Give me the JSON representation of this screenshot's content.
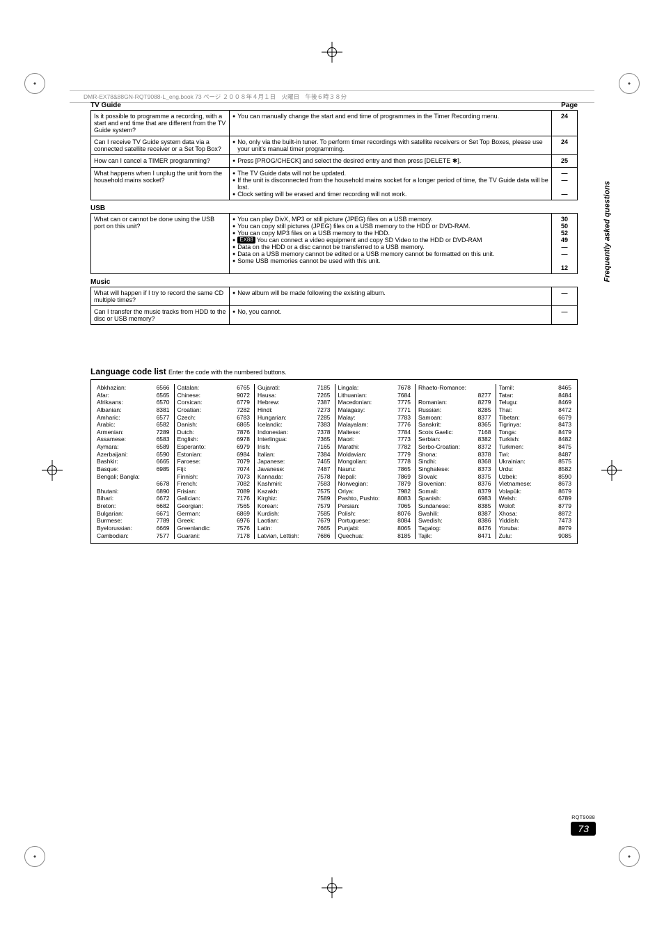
{
  "header_strip": "DMR-EX78&88GN-RQT9088-L_eng.book  73 ページ  ２００８年４月１日　火曜日　午後６時３８分",
  "side_label": "Frequently asked questions",
  "page_label": "Page",
  "sections": {
    "tvguide": {
      "title": "TV Guide",
      "rows": [
        {
          "q": "Is it possible to programme a recording, with a start and end time that are different from the TV Guide system?",
          "a": [
            "You can manually change the start and end time of programmes in the Timer Recording menu."
          ],
          "p": [
            "24"
          ]
        },
        {
          "q": "Can I receive TV Guide system data via a connected satellite receiver or a Set Top Box?",
          "a": [
            "No, only via the built-in tuner. To perform timer recordings with satellite receivers or Set Top Boxes, please use your unit's manual timer programming."
          ],
          "p": [
            "24"
          ]
        },
        {
          "q": "How can I cancel a TIMER programming?",
          "a": [
            "Press [PROG/CHECK] and select the desired entry and then press [DELETE ✱]."
          ],
          "p": [
            "25"
          ]
        },
        {
          "q": "What happens when I unplug the unit from the household mains socket?",
          "a": [
            "The TV Guide data will not be updated.",
            "If the unit is disconnected from the household mains socket for a longer period of time, the TV Guide data will be lost.",
            "Clock setting will be erased and timer recording will not work."
          ],
          "p": [
            "—",
            "—",
            "",
            "—"
          ]
        }
      ]
    },
    "usb": {
      "title": "USB",
      "rows": [
        {
          "q": "What can or cannot be done using the USB port on this unit?",
          "a": [
            "You can play DivX, MP3 or still picture (JPEG) files on a USB memory.",
            "You can copy still pictures (JPEG) files on a USB memory to the HDD or DVD-RAM.",
            "You can copy MP3 files on a USB memory to the HDD.",
            {
              "badge": "EX88",
              "text": "You can connect a video equipment and copy SD Video to the HDD or DVD-RAM"
            },
            "Data on the HDD or a disc cannot be transferred to a USB memory.",
            "Data on a USB memory cannot be edited or a USB memory cannot be formatted on this unit.",
            "Some USB memories cannot be used with this unit."
          ],
          "p": [
            "30",
            "50",
            "52",
            "49",
            "—",
            "—",
            "",
            "12"
          ]
        }
      ]
    },
    "music": {
      "title": "Music",
      "rows": [
        {
          "q": "What will happen if I try to record the same CD multiple times?",
          "a": [
            "New album will be made following the existing album."
          ],
          "p": [
            "—"
          ]
        },
        {
          "q": "Can I transfer the music tracks from HDD to the disc or USB memory?",
          "a": [
            "No, you cannot."
          ],
          "p": [
            "—"
          ]
        }
      ]
    }
  },
  "lang_title": "Language code list",
  "lang_sub": "Enter the code with the numbered buttons.",
  "lang_cols": [
    [
      [
        "Abkhazian:",
        "6566"
      ],
      [
        "Afar:",
        "6565"
      ],
      [
        "Afrikaans:",
        "6570"
      ],
      [
        "Albanian:",
        "8381"
      ],
      [
        "Amharic:",
        "6577"
      ],
      [
        "Arabic:",
        "6582"
      ],
      [
        "Armenian:",
        "7289"
      ],
      [
        "Assamese:",
        "6583"
      ],
      [
        "Aymara:",
        "6589"
      ],
      [
        "Azerbaijani:",
        "6590"
      ],
      [
        "Bashkir:",
        "6665"
      ],
      [
        "Basque:",
        "6985"
      ],
      [
        "Bengali; Bangla:",
        ""
      ],
      [
        "",
        "6678"
      ],
      [
        "Bhutani:",
        "6890"
      ],
      [
        "Bihari:",
        "6672"
      ],
      [
        "Breton:",
        "6682"
      ],
      [
        "Bulgarian:",
        "6671"
      ],
      [
        "Burmese:",
        "7789"
      ],
      [
        "Byelorussian:",
        "6669"
      ],
      [
        "Cambodian:",
        "7577"
      ]
    ],
    [
      [
        "Catalan:",
        "6765"
      ],
      [
        "Chinese:",
        "9072"
      ],
      [
        "Corsican:",
        "6779"
      ],
      [
        "Croatian:",
        "7282"
      ],
      [
        "Czech:",
        "6783"
      ],
      [
        "Danish:",
        "6865"
      ],
      [
        "Dutch:",
        "7876"
      ],
      [
        "English:",
        "6978"
      ],
      [
        "Esperanto:",
        "6979"
      ],
      [
        "Estonian:",
        "6984"
      ],
      [
        "Faroese:",
        "7079"
      ],
      [
        "Fiji:",
        "7074"
      ],
      [
        "Finnish:",
        "7073"
      ],
      [
        "French:",
        "7082"
      ],
      [
        "Frisian:",
        "7089"
      ],
      [
        "Galician:",
        "7176"
      ],
      [
        "Georgian:",
        "7565"
      ],
      [
        "German:",
        "6869"
      ],
      [
        "Greek:",
        "6976"
      ],
      [
        "Greenlandic:",
        "7576"
      ],
      [
        "Guarani:",
        "7178"
      ]
    ],
    [
      [
        "Gujarati:",
        "7185"
      ],
      [
        "Hausa:",
        "7265"
      ],
      [
        "Hebrew:",
        "7387"
      ],
      [
        "Hindi:",
        "7273"
      ],
      [
        "Hungarian:",
        "7285"
      ],
      [
        "Icelandic:",
        "7383"
      ],
      [
        "Indonesian:",
        "7378"
      ],
      [
        "Interlingua:",
        "7365"
      ],
      [
        "Irish:",
        "7165"
      ],
      [
        "Italian:",
        "7384"
      ],
      [
        "Japanese:",
        "7465"
      ],
      [
        "Javanese:",
        "7487"
      ],
      [
        "Kannada:",
        "7578"
      ],
      [
        "Kashmiri:",
        "7583"
      ],
      [
        "Kazakh:",
        "7575"
      ],
      [
        "Kirghiz:",
        "7589"
      ],
      [
        "Korean:",
        "7579"
      ],
      [
        "Kurdish:",
        "7585"
      ],
      [
        "Laotian:",
        "7679"
      ],
      [
        "Latin:",
        "7665"
      ],
      [
        "Latvian, Lettish:",
        "7686"
      ]
    ],
    [
      [
        "Lingala:",
        "7678"
      ],
      [
        "Lithuanian:",
        "7684"
      ],
      [
        "Macedonian:",
        "7775"
      ],
      [
        "Malagasy:",
        "7771"
      ],
      [
        "Malay:",
        "7783"
      ],
      [
        "Malayalam:",
        "7776"
      ],
      [
        "Maltese:",
        "7784"
      ],
      [
        "Maori:",
        "7773"
      ],
      [
        "Marathi:",
        "7782"
      ],
      [
        "Moldavian:",
        "7779"
      ],
      [
        "Mongolian:",
        "7778"
      ],
      [
        "Nauru:",
        "7865"
      ],
      [
        "Nepali:",
        "7869"
      ],
      [
        "Norwegian:",
        "7879"
      ],
      [
        "Oriya:",
        "7982"
      ],
      [
        "Pashto, Pushto:",
        "8083"
      ],
      [
        "Persian:",
        "7065"
      ],
      [
        "Polish:",
        "8076"
      ],
      [
        "Portuguese:",
        "8084"
      ],
      [
        "Punjabi:",
        "8065"
      ],
      [
        "Quechua:",
        "8185"
      ]
    ],
    [
      [
        "Rhaeto-Romance:",
        ""
      ],
      [
        "",
        "8277"
      ],
      [
        "Romanian:",
        "8279"
      ],
      [
        "Russian:",
        "8285"
      ],
      [
        "Samoan:",
        "8377"
      ],
      [
        "Sanskrit:",
        "8365"
      ],
      [
        "Scots Gaelic:",
        "7168"
      ],
      [
        "Serbian:",
        "8382"
      ],
      [
        "Serbo-Croatian:",
        "8372"
      ],
      [
        "Shona:",
        "8378"
      ],
      [
        "Sindhi:",
        "8368"
      ],
      [
        "Singhalese:",
        "8373"
      ],
      [
        "Slovak:",
        "8375"
      ],
      [
        "Slovenian:",
        "8376"
      ],
      [
        "Somali:",
        "8379"
      ],
      [
        "Spanish:",
        "6983"
      ],
      [
        "Sundanese:",
        "8385"
      ],
      [
        "Swahili:",
        "8387"
      ],
      [
        "Swedish:",
        "8386"
      ],
      [
        "Tagalog:",
        "8476"
      ],
      [
        "Tajik:",
        "8471"
      ]
    ],
    [
      [
        "Tamil:",
        "8465"
      ],
      [
        "Tatar:",
        "8484"
      ],
      [
        "Telugu:",
        "8469"
      ],
      [
        "Thai:",
        "8472"
      ],
      [
        "Tibetan:",
        "6679"
      ],
      [
        "Tigrinya:",
        "8473"
      ],
      [
        "Tonga:",
        "8479"
      ],
      [
        "Turkish:",
        "8482"
      ],
      [
        "Turkmen:",
        "8475"
      ],
      [
        "Twi:",
        "8487"
      ],
      [
        "Ukrainian:",
        "8575"
      ],
      [
        "Urdu:",
        "8582"
      ],
      [
        "Uzbek:",
        "8590"
      ],
      [
        "Vietnamese:",
        "8673"
      ],
      [
        "Volapük:",
        "8679"
      ],
      [
        "Welsh:",
        "6789"
      ],
      [
        "Wolof:",
        "8779"
      ],
      [
        "Xhosa:",
        "8872"
      ],
      [
        "Yiddish:",
        "7473"
      ],
      [
        "Yoruba:",
        "8979"
      ],
      [
        "Zulu:",
        "9085"
      ]
    ]
  ],
  "footer": {
    "rq": "RQT9088",
    "page": "73"
  }
}
